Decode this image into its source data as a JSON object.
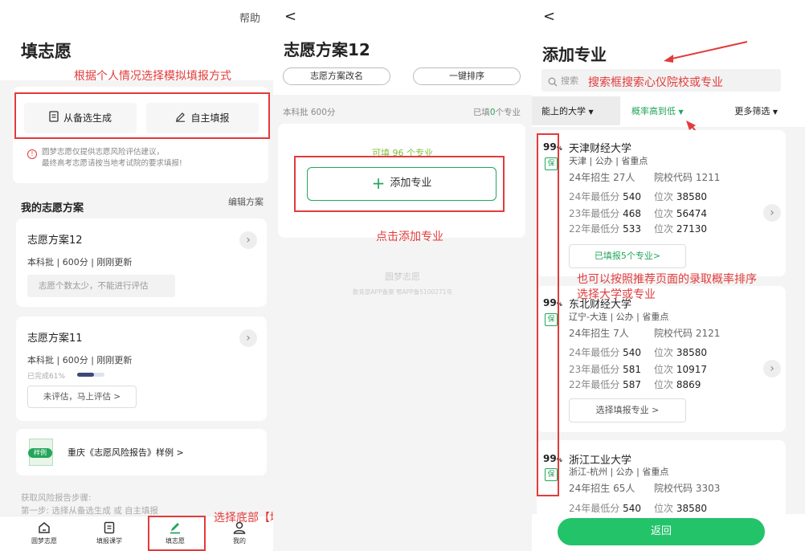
{
  "colors": {
    "accent": "#23a65a",
    "annotation": "#e23b3b"
  },
  "panel1": {
    "help": "帮助",
    "title": "填志愿",
    "annotation_top": "根据个人情况选择模拟填报方式",
    "btn_candidate": "从备选生成",
    "btn_self": "自主填报",
    "notice_line1": "圆梦志愿仅提供志愿风险评估建议，",
    "notice_line2": "最终高考志愿请按当地考试院的要求填报!",
    "my_plans": "我的志愿方案",
    "edit_plan": "编辑方案",
    "plan1": {
      "name": "志愿方案12",
      "meta": "本科批 | 600分 | 刚刚更新",
      "hint": "志愿个数太少，不能进行评估"
    },
    "plan2": {
      "name": "志愿方案11",
      "meta": "本科批 | 600分 | 刚刚更新",
      "progress_text": "已完成61%",
      "progress": 0.61,
      "eval_btn": "未评估，马上评估 >"
    },
    "report_badge": "样例",
    "report_link": "重庆《志愿风险报告》样例 >",
    "steps_title": "获取风险报告步骤:",
    "steps_line": "第一步: 选择从备选生成 或 自主填报",
    "annotation_bottom": "选择底部【填志愿】项",
    "nav": [
      "圆梦志愿",
      "填报课学",
      "填志愿",
      "我的"
    ],
    "nav_active": 2
  },
  "panel2": {
    "back": "<",
    "title": "志愿方案12",
    "rename": "志愿方案改名",
    "sort": "一键排序",
    "batch": "本科批 600分",
    "filled_prefix": "已填",
    "filled_count": "0",
    "filled_suffix": "个专业",
    "can_fill": "可填 96 个专业",
    "add_major": "添加专业",
    "annotation": "点击添加专业",
    "watermark": "圆梦志愿",
    "footer": "教育部APP备案  鄂APP备5100271号"
  },
  "panel3": {
    "back": "<",
    "title": "添加专业",
    "search_placeholder": "搜索",
    "search_annotation": "搜索框搜索心仪院校或专业",
    "filter_reachable": "能上的大学",
    "filter_prob": "概率高到低",
    "filter_more": "更多筛选",
    "annotation_sort_1": "也可以按照推荐页面的录取概率排序",
    "annotation_sort_2": "选择大学或专业",
    "back_btn": "返回",
    "unis": [
      {
        "prob": "99",
        "unit": "%",
        "tag": "保",
        "name": "天津财经大学",
        "loc": "天津 | 公办 | 省重点",
        "enroll": "24年招生 27人",
        "code": "院校代码 1211",
        "scores": [
          {
            "label": "24年最低分",
            "score": "540",
            "rank_label": "位次",
            "rank": "38580"
          },
          {
            "label": "23年最低分",
            "score": "468",
            "rank_label": "位次",
            "rank": "56474"
          },
          {
            "label": "22年最低分",
            "score": "533",
            "rank_label": "位次",
            "rank": "27130"
          }
        ],
        "action": "已填报5个专业>"
      },
      {
        "prob": "99",
        "unit": "%",
        "tag": "保",
        "name": "东北财经大学",
        "loc": "辽宁-大连 | 公办 | 省重点",
        "enroll": "24年招生 7人",
        "code": "院校代码 2121",
        "scores": [
          {
            "label": "24年最低分",
            "score": "540",
            "rank_label": "位次",
            "rank": "38580"
          },
          {
            "label": "23年最低分",
            "score": "581",
            "rank_label": "位次",
            "rank": "10917"
          },
          {
            "label": "22年最低分",
            "score": "587",
            "rank_label": "位次",
            "rank": "8869"
          }
        ],
        "action": "选择填报专业 >"
      },
      {
        "prob": "99",
        "unit": "%",
        "tag": "保",
        "name": "浙江工业大学",
        "loc": "浙江-杭州 | 公办 | 省重点",
        "enroll": "24年招生 65人",
        "code": "院校代码 3303",
        "scores": [
          {
            "label": "24年最低分",
            "score": "540",
            "rank_label": "位次",
            "rank": "38580"
          }
        ]
      }
    ]
  }
}
